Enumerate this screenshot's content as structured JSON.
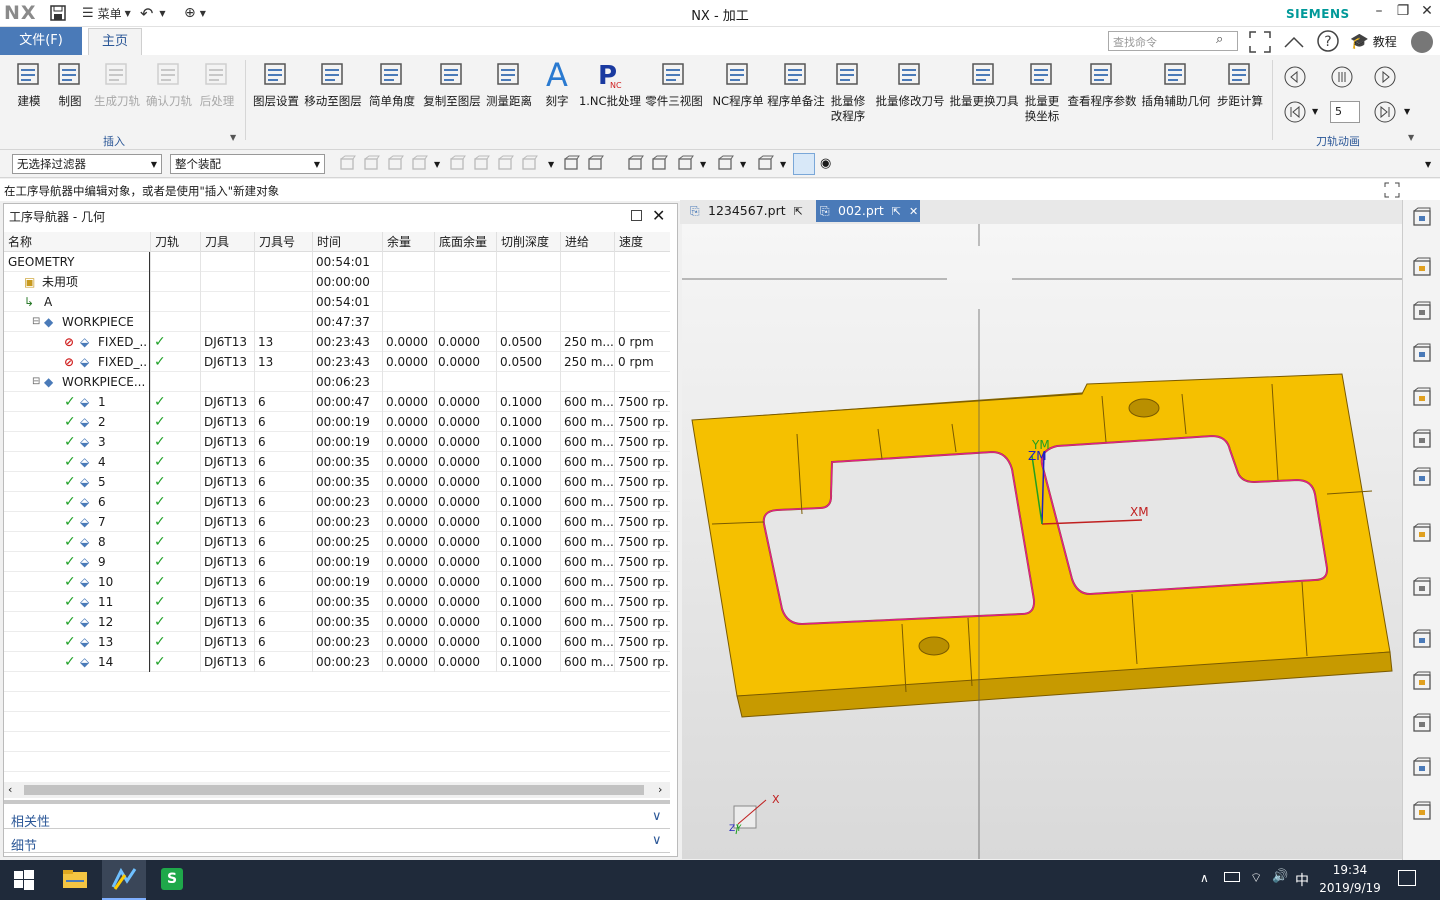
{
  "app": {
    "logo": "NX",
    "title": "NX - 加工",
    "brand": "SIEMENS",
    "menu_label": "菜单",
    "tutorial_label": "教程",
    "search_placeholder": "查找命令"
  },
  "tabs": {
    "file": "文件(F)",
    "home": "主页"
  },
  "ribbon": {
    "buttons": [
      {
        "label": "建模",
        "enabled": true
      },
      {
        "label": "制图",
        "enabled": true
      },
      {
        "label": "生成刀轨",
        "enabled": false
      },
      {
        "label": "确认刀轨",
        "enabled": false
      },
      {
        "label": "后处理",
        "enabled": false
      },
      {
        "label": "图层设置",
        "enabled": true
      },
      {
        "label": "移动至图层",
        "enabled": true
      },
      {
        "label": "简单角度",
        "enabled": true
      },
      {
        "label": "复制至图层",
        "enabled": true
      },
      {
        "label": "测量距离",
        "enabled": true
      },
      {
        "label": "刻字",
        "enabled": true
      },
      {
        "label": "1.NC批处理",
        "enabled": true
      },
      {
        "label": "零件三视图",
        "enabled": true
      },
      {
        "label": "NC程序单",
        "enabled": true
      },
      {
        "label": "程序单备注",
        "enabled": true
      },
      {
        "label": "批量修\n改程序",
        "enabled": true
      },
      {
        "label": "批量修改刀号",
        "enabled": true
      },
      {
        "label": "批量更换刀具",
        "enabled": true
      },
      {
        "label": "批量更\n换坐标",
        "enabled": true
      },
      {
        "label": "查看程序参数",
        "enabled": true
      },
      {
        "label": "插角辅助几何",
        "enabled": true
      },
      {
        "label": "步距计算",
        "enabled": true
      }
    ],
    "group_insert": "插入",
    "group_animation": "刀轨动画",
    "animation_speed": "5"
  },
  "filters": {
    "selection_filter": "无选择过滤器",
    "assembly": "整个装配"
  },
  "cue_line": "在工序导航器中编辑对象，或者是使用\"插入\"新建对象",
  "navigator": {
    "title": "工序导航器 - 几何",
    "columns": [
      "名称",
      "刀轨",
      "刀具",
      "刀具号",
      "时间",
      "余量",
      "底面余量",
      "切削深度",
      "进给",
      "速度"
    ],
    "rows": [
      {
        "indent": 0,
        "icon": "none",
        "name": "GEOMETRY",
        "path": "",
        "tool": "",
        "toolno": "",
        "time": "00:54:01",
        "stock": "",
        "floor": "",
        "depth": "",
        "feed": "",
        "speed": ""
      },
      {
        "indent": 1,
        "icon": "folder",
        "name": "未用项",
        "path": "",
        "tool": "",
        "toolno": "",
        "time": "00:00:00",
        "stock": "",
        "floor": "",
        "depth": "",
        "feed": "",
        "speed": ""
      },
      {
        "indent": 1,
        "icon": "mcs",
        "name": "A",
        "path": "",
        "tool": "",
        "toolno": "",
        "time": "00:54:01",
        "stock": "",
        "floor": "",
        "depth": "",
        "feed": "",
        "speed": ""
      },
      {
        "indent": 2,
        "icon": "workpiece",
        "name": "WORKPIECE",
        "path": "",
        "tool": "",
        "toolno": "",
        "time": "00:47:37",
        "stock": "",
        "floor": "",
        "depth": "",
        "feed": "",
        "speed": ""
      },
      {
        "indent": 3,
        "icon": "blocked",
        "name": "FIXED_...",
        "path": "ok",
        "tool": "DJ6T13",
        "toolno": "13",
        "time": "00:23:43",
        "stock": "0.0000",
        "floor": "0.0000",
        "depth": "0.0500",
        "feed": "250 m...",
        "speed": "0 rpm"
      },
      {
        "indent": 3,
        "icon": "blocked",
        "name": "FIXED_...",
        "path": "ok",
        "tool": "DJ6T13",
        "toolno": "13",
        "time": "00:23:43",
        "stock": "0.0000",
        "floor": "0.0000",
        "depth": "0.0500",
        "feed": "250 m...",
        "speed": "0 rpm"
      },
      {
        "indent": 2,
        "icon": "workpiece",
        "name": "WORKPIECE...",
        "path": "",
        "tool": "",
        "toolno": "",
        "time": "00:06:23",
        "stock": "",
        "floor": "",
        "depth": "",
        "feed": "",
        "speed": ""
      },
      {
        "indent": 3,
        "icon": "done",
        "name": "1",
        "path": "ok",
        "tool": "DJ6T13",
        "toolno": "6",
        "time": "00:00:47",
        "stock": "0.0000",
        "floor": "0.0000",
        "depth": "0.1000",
        "feed": "600 m...",
        "speed": "7500 rp..."
      },
      {
        "indent": 3,
        "icon": "done",
        "name": "2",
        "path": "ok",
        "tool": "DJ6T13",
        "toolno": "6",
        "time": "00:00:19",
        "stock": "0.0000",
        "floor": "0.0000",
        "depth": "0.1000",
        "feed": "600 m...",
        "speed": "7500 rp..."
      },
      {
        "indent": 3,
        "icon": "done",
        "name": "3",
        "path": "ok",
        "tool": "DJ6T13",
        "toolno": "6",
        "time": "00:00:19",
        "stock": "0.0000",
        "floor": "0.0000",
        "depth": "0.1000",
        "feed": "600 m...",
        "speed": "7500 rp..."
      },
      {
        "indent": 3,
        "icon": "done",
        "name": "4",
        "path": "ok",
        "tool": "DJ6T13",
        "toolno": "6",
        "time": "00:00:35",
        "stock": "0.0000",
        "floor": "0.0000",
        "depth": "0.1000",
        "feed": "600 m...",
        "speed": "7500 rp..."
      },
      {
        "indent": 3,
        "icon": "done",
        "name": "5",
        "path": "ok",
        "tool": "DJ6T13",
        "toolno": "6",
        "time": "00:00:35",
        "stock": "0.0000",
        "floor": "0.0000",
        "depth": "0.1000",
        "feed": "600 m...",
        "speed": "7500 rp..."
      },
      {
        "indent": 3,
        "icon": "done",
        "name": "6",
        "path": "ok",
        "tool": "DJ6T13",
        "toolno": "6",
        "time": "00:00:23",
        "stock": "0.0000",
        "floor": "0.0000",
        "depth": "0.1000",
        "feed": "600 m...",
        "speed": "7500 rp..."
      },
      {
        "indent": 3,
        "icon": "done",
        "name": "7",
        "path": "ok",
        "tool": "DJ6T13",
        "toolno": "6",
        "time": "00:00:23",
        "stock": "0.0000",
        "floor": "0.0000",
        "depth": "0.1000",
        "feed": "600 m...",
        "speed": "7500 rp..."
      },
      {
        "indent": 3,
        "icon": "done",
        "name": "8",
        "path": "ok",
        "tool": "DJ6T13",
        "toolno": "6",
        "time": "00:00:25",
        "stock": "0.0000",
        "floor": "0.0000",
        "depth": "0.1000",
        "feed": "600 m...",
        "speed": "7500 rp..."
      },
      {
        "indent": 3,
        "icon": "done",
        "name": "9",
        "path": "ok",
        "tool": "DJ6T13",
        "toolno": "6",
        "time": "00:00:19",
        "stock": "0.0000",
        "floor": "0.0000",
        "depth": "0.1000",
        "feed": "600 m...",
        "speed": "7500 rp..."
      },
      {
        "indent": 3,
        "icon": "done",
        "name": "10",
        "path": "ok",
        "tool": "DJ6T13",
        "toolno": "6",
        "time": "00:00:19",
        "stock": "0.0000",
        "floor": "0.0000",
        "depth": "0.1000",
        "feed": "600 m...",
        "speed": "7500 rp..."
      },
      {
        "indent": 3,
        "icon": "done",
        "name": "11",
        "path": "ok",
        "tool": "DJ6T13",
        "toolno": "6",
        "time": "00:00:35",
        "stock": "0.0000",
        "floor": "0.0000",
        "depth": "0.1000",
        "feed": "600 m...",
        "speed": "7500 rp..."
      },
      {
        "indent": 3,
        "icon": "done",
        "name": "12",
        "path": "ok",
        "tool": "DJ6T13",
        "toolno": "6",
        "time": "00:00:35",
        "stock": "0.0000",
        "floor": "0.0000",
        "depth": "0.1000",
        "feed": "600 m...",
        "speed": "7500 rp..."
      },
      {
        "indent": 3,
        "icon": "done",
        "name": "13",
        "path": "ok",
        "tool": "DJ6T13",
        "toolno": "6",
        "time": "00:00:23",
        "stock": "0.0000",
        "floor": "0.0000",
        "depth": "0.1000",
        "feed": "600 m...",
        "speed": "7500 rp..."
      },
      {
        "indent": 3,
        "icon": "done",
        "name": "14",
        "path": "ok",
        "tool": "DJ6T13",
        "toolno": "6",
        "time": "00:00:23",
        "stock": "0.0000",
        "floor": "0.0000",
        "depth": "0.1000",
        "feed": "600 m...",
        "speed": "7500 rp..."
      }
    ],
    "panel_dependencies": "相关性",
    "panel_details": "细节"
  },
  "documents": [
    {
      "name": "1234567.prt",
      "active": false
    },
    {
      "name": "002.prt",
      "active": true
    }
  ],
  "viewport": {
    "axis_x": "XM",
    "axis_y": "YM",
    "axis_z": "ZM",
    "triad_x": "X",
    "triad_y": "Y",
    "triad_z": "Z",
    "part_color": "#f5c000",
    "toolpath_color": "#e0208a"
  },
  "taskbar": {
    "time": "19:34",
    "date": "2019/9/19",
    "ime": "中"
  },
  "colors": {
    "accent": "#4a7ab8",
    "brand": "#009999",
    "check": "#22a22a"
  }
}
